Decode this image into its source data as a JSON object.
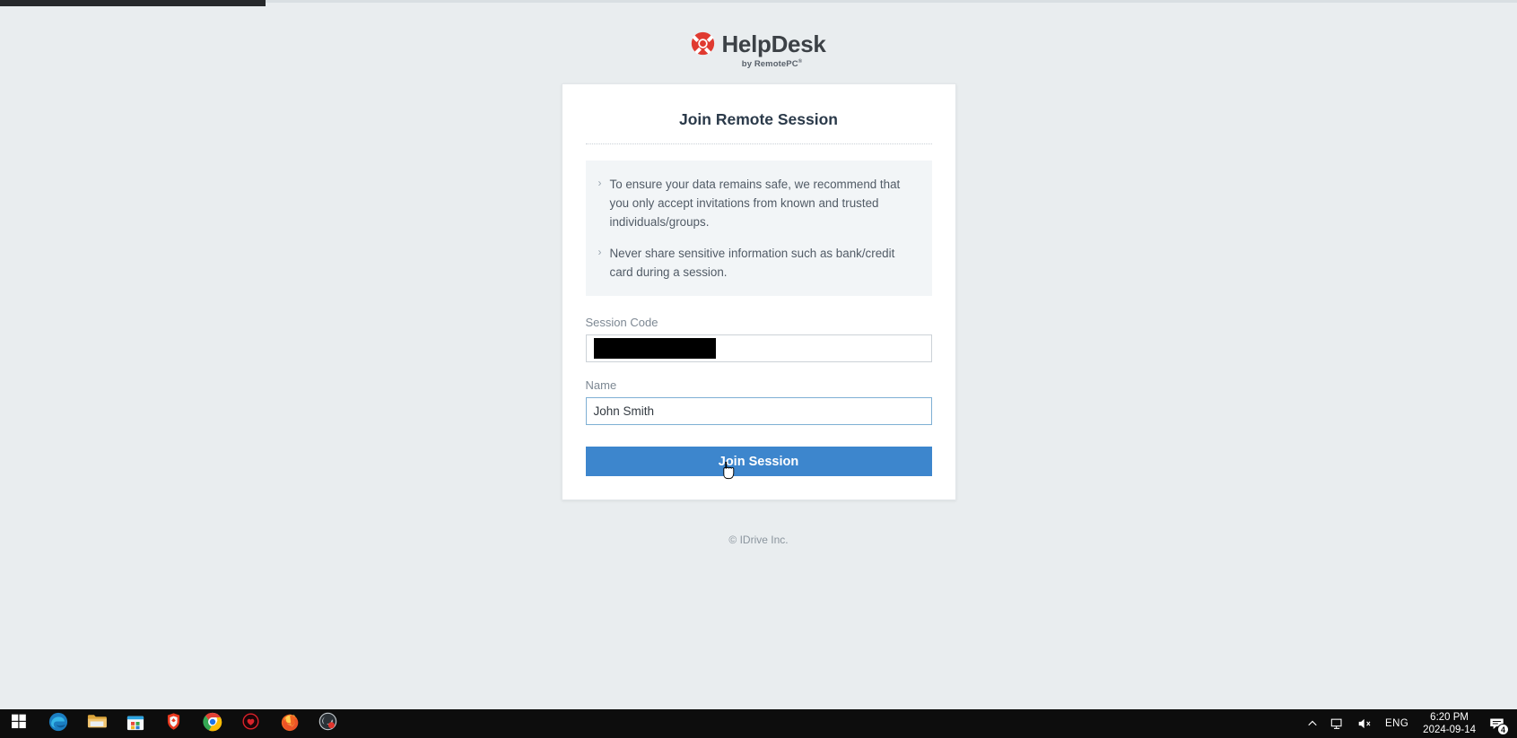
{
  "brand": {
    "name": "HelpDesk",
    "tagline": "by RemotePC",
    "tagline_sup": "®",
    "logo_icon": "life-ring-icon",
    "logo_color": "#e03a30"
  },
  "card": {
    "title": "Join Remote Session",
    "notice": {
      "bullet_glyph": "›",
      "items": [
        "To ensure your data remains safe, we recommend that you only accept invitations from known and trusted individuals/groups.",
        "Never share sensitive information such as bank/credit card during a session."
      ]
    },
    "fields": [
      {
        "label": "Session Code",
        "value": "",
        "placeholder": "",
        "redacted": true,
        "focused": false
      },
      {
        "label": "Name",
        "value": "John Smith",
        "placeholder": "",
        "redacted": false,
        "focused": true
      }
    ],
    "submit_label": "Join Session",
    "submit_color": "#3d86cd"
  },
  "footer": {
    "copyright": "© IDrive Inc."
  },
  "taskbar": {
    "items": [
      {
        "name": "start-button",
        "icon": "windows-logo-icon"
      },
      {
        "name": "taskbar-edge",
        "icon": "edge-icon"
      },
      {
        "name": "taskbar-file-explorer",
        "icon": "folder-icon"
      },
      {
        "name": "taskbar-microsoft-store",
        "icon": "store-icon"
      },
      {
        "name": "taskbar-brave",
        "icon": "brave-icon"
      },
      {
        "name": "taskbar-chrome",
        "icon": "chrome-icon"
      },
      {
        "name": "taskbar-app-red",
        "icon": "red-shield-icon"
      },
      {
        "name": "taskbar-firefox",
        "icon": "firefox-icon"
      },
      {
        "name": "taskbar-obs",
        "icon": "obs-icon"
      }
    ],
    "tray": {
      "overflow_icon": "chevron-up-icon",
      "network_icon": "network-monitor-icon",
      "volume_icon": "speaker-muted-icon",
      "language": "ENG",
      "time": "6:20 PM",
      "date": "2024-09-14",
      "notification_icon": "notification-icon",
      "notification_count": "4"
    }
  }
}
